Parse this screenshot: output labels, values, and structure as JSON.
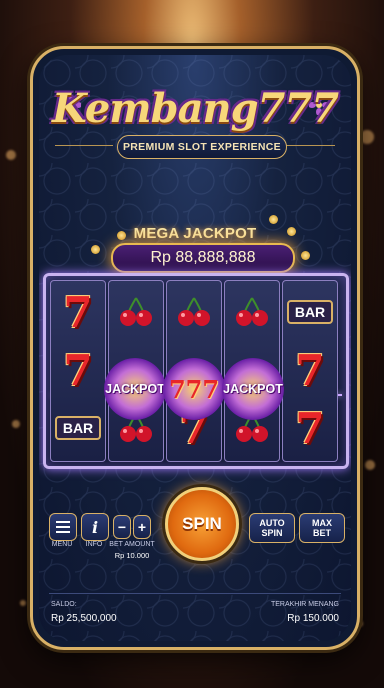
{
  "header": {
    "logo_text": "Kembang777",
    "subtitle": "PREMIUM SLOT EXPERIENCE"
  },
  "jackpot": {
    "title": "MEGA JACKPOT",
    "amount": "Rp 88,888,888"
  },
  "reels": [
    [
      "seven",
      "seven",
      "bar"
    ],
    [
      "cherry",
      "jackpot",
      "cherry"
    ],
    [
      "cherry",
      "777",
      "seven"
    ],
    [
      "cherry",
      "jackpot",
      "cherry"
    ],
    [
      "bar",
      "seven",
      "seven"
    ]
  ],
  "symbols": {
    "seven": "7",
    "bar": "BAR",
    "jackpot": "JACKPOT",
    "triple_seven": "777"
  },
  "controls": {
    "menu_label": "MENU",
    "info_icon": "i",
    "info_label": "INFO",
    "bet_minus": "−",
    "bet_plus": "+",
    "bet_amount_label": "BET AMOUNT",
    "bet_amount_value": "Rp 10.000",
    "spin_label": "SPIN",
    "auto_spin_line1": "AUTO",
    "auto_spin_line2": "SPIN",
    "max_bet_line1": "MAX",
    "max_bet_line2": "BET"
  },
  "footer": {
    "saldo_label": "SALDO:",
    "saldo_value": "Rp 25,500,000",
    "last_win_label": "TERAKHIR MENANG",
    "last_win_value": "Rp 150.000"
  },
  "colors": {
    "gold": "#d9b166",
    "reel_glow": "#c9b3f0",
    "spin_orange": "#e06a10",
    "seven_red": "#e8262a"
  }
}
